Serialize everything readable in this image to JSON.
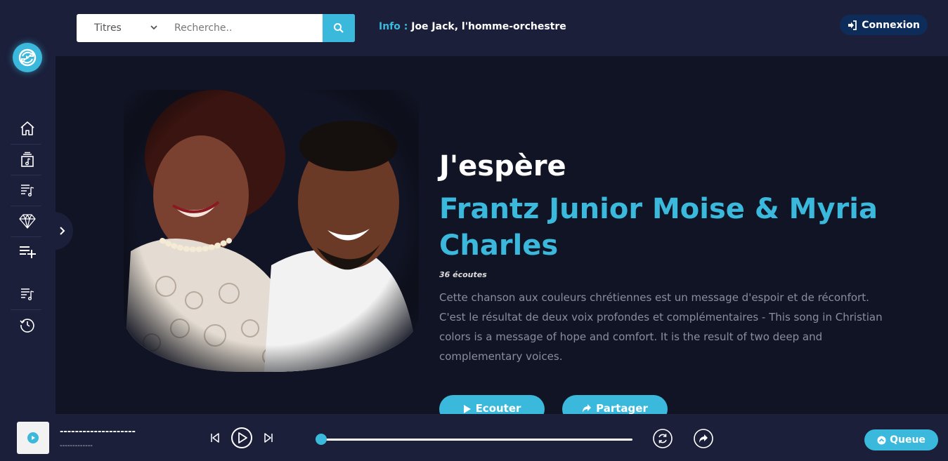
{
  "topbar": {
    "search_select": "Titres",
    "search_placeholder": "Recherche..",
    "info_label": "Info :",
    "info_text": "Joe Jack, l'homme-orchestre",
    "login_label": "Connexion"
  },
  "sidebar": {
    "items": [
      {
        "name": "home",
        "icon": "home-icon"
      },
      {
        "name": "albums",
        "icon": "album-icon"
      },
      {
        "name": "playlists",
        "icon": "playlist-icon"
      },
      {
        "name": "premium",
        "icon": "diamond-icon"
      },
      {
        "name": "add-playlist",
        "icon": "playlist-add-icon"
      },
      {
        "name": "my-playlists",
        "icon": "playlist-icon"
      },
      {
        "name": "history",
        "icon": "history-icon"
      }
    ]
  },
  "hero": {
    "title": "J'espère",
    "artist": "Frantz Junior Moise & Myria Charles",
    "listens": "36 écoutes",
    "description": "Cette chanson aux couleurs chrétiennes est un message d'espoir et de réconfort. C'est le résultat de deux voix profondes et complémentaires - This song in Christian colors is a message of hope and comfort. It is the result of two deep and complementary voices.",
    "listen_label": "Ecouter",
    "share_label": "Partager"
  },
  "player": {
    "track_title": "--------------------",
    "track_artist": "-------------",
    "progress": 0,
    "queue_label": "Queue"
  },
  "colors": {
    "accent": "#3bb9dc",
    "sidebar_bg": "#1b1f3a",
    "main_bg": "#111424"
  }
}
